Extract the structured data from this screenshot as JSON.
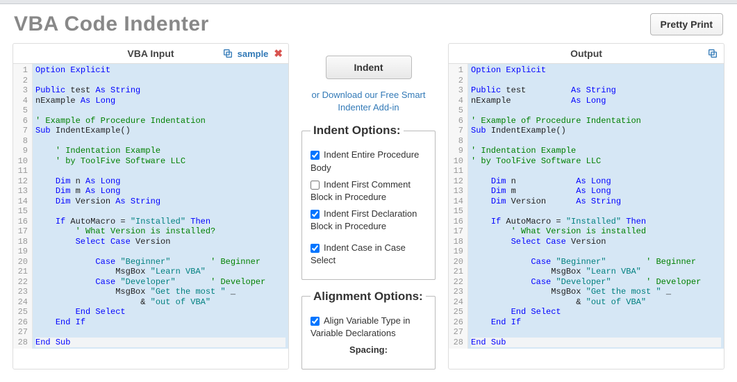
{
  "header": {
    "title": "VBA Code Indenter",
    "pretty_print": "Pretty Print"
  },
  "input_panel": {
    "title": "VBA Input",
    "sample_label": "sample",
    "clear_label": "✖",
    "code": [
      [
        [
          "kw",
          "Option"
        ],
        [
          "sp",
          " "
        ],
        [
          "kw",
          "Explicit"
        ]
      ],
      [],
      [
        [
          "kw",
          "Public"
        ],
        [
          "sp",
          " "
        ],
        [
          "id",
          "test "
        ],
        [
          "kw",
          "As"
        ],
        [
          "sp",
          " "
        ],
        [
          "kw",
          "String"
        ]
      ],
      [
        [
          "id",
          "nExample "
        ],
        [
          "kw",
          "As"
        ],
        [
          "sp",
          " "
        ],
        [
          "kw",
          "Long"
        ]
      ],
      [],
      [
        [
          "cm",
          "' Example of Procedure Indentation"
        ]
      ],
      [
        [
          "kw",
          "Sub"
        ],
        [
          "sp",
          " "
        ],
        [
          "id",
          "IndentExample()"
        ]
      ],
      [],
      [
        [
          "sp",
          "    "
        ],
        [
          "cm",
          "' Indentation Example"
        ]
      ],
      [
        [
          "sp",
          "    "
        ],
        [
          "cm",
          "' by ToolFive Software LLC"
        ]
      ],
      [],
      [
        [
          "sp",
          "    "
        ],
        [
          "kw",
          "Dim"
        ],
        [
          "sp",
          " "
        ],
        [
          "id",
          "n "
        ],
        [
          "kw",
          "As"
        ],
        [
          "sp",
          " "
        ],
        [
          "kw",
          "Long"
        ]
      ],
      [
        [
          "sp",
          "    "
        ],
        [
          "kw",
          "Dim"
        ],
        [
          "sp",
          " "
        ],
        [
          "id",
          "m "
        ],
        [
          "kw",
          "As"
        ],
        [
          "sp",
          " "
        ],
        [
          "kw",
          "Long"
        ]
      ],
      [
        [
          "sp",
          "    "
        ],
        [
          "kw",
          "Dim"
        ],
        [
          "sp",
          " "
        ],
        [
          "id",
          "Version "
        ],
        [
          "kw",
          "As"
        ],
        [
          "sp",
          " "
        ],
        [
          "kw",
          "String"
        ]
      ],
      [],
      [
        [
          "sp",
          "    "
        ],
        [
          "kw",
          "If"
        ],
        [
          "sp",
          " "
        ],
        [
          "id",
          "AutoMacro = "
        ],
        [
          "st",
          "\"Installed\""
        ],
        [
          "sp",
          " "
        ],
        [
          "kw",
          "Then"
        ]
      ],
      [
        [
          "sp",
          "        "
        ],
        [
          "cm",
          "' What Version is installed?"
        ]
      ],
      [
        [
          "sp",
          "        "
        ],
        [
          "kw",
          "Select"
        ],
        [
          "sp",
          " "
        ],
        [
          "kw",
          "Case"
        ],
        [
          "sp",
          " "
        ],
        [
          "id",
          "Version"
        ]
      ],
      [],
      [
        [
          "sp",
          "            "
        ],
        [
          "kw",
          "Case"
        ],
        [
          "sp",
          " "
        ],
        [
          "st",
          "\"Beginner\""
        ],
        [
          "sp",
          "        "
        ],
        [
          "cm",
          "' Beginner"
        ]
      ],
      [
        [
          "sp",
          "                "
        ],
        [
          "id",
          "MsgBox "
        ],
        [
          "st",
          "\"Learn VBA\""
        ]
      ],
      [
        [
          "sp",
          "            "
        ],
        [
          "kw",
          "Case"
        ],
        [
          "sp",
          " "
        ],
        [
          "st",
          "\"Developer\""
        ],
        [
          "sp",
          "       "
        ],
        [
          "cm",
          "' Developer"
        ]
      ],
      [
        [
          "sp",
          "                "
        ],
        [
          "id",
          "MsgBox "
        ],
        [
          "st",
          "\"Get the most \""
        ],
        [
          "id",
          " _"
        ]
      ],
      [
        [
          "sp",
          "                     "
        ],
        [
          "id",
          "& "
        ],
        [
          "st",
          "\"out of VBA\""
        ]
      ],
      [
        [
          "sp",
          "        "
        ],
        [
          "kw",
          "End"
        ],
        [
          "sp",
          " "
        ],
        [
          "kw",
          "Select"
        ]
      ],
      [
        [
          "sp",
          "    "
        ],
        [
          "kw",
          "End"
        ],
        [
          "sp",
          " "
        ],
        [
          "kw",
          "If"
        ]
      ],
      [],
      [
        [
          "kw",
          "End"
        ],
        [
          "sp",
          " "
        ],
        [
          "kw",
          "Sub"
        ]
      ]
    ]
  },
  "output_panel": {
    "title": "Output",
    "code": [
      [
        [
          "kw",
          "Option"
        ],
        [
          "sp",
          " "
        ],
        [
          "kw",
          "Explicit"
        ]
      ],
      [],
      [
        [
          "kw",
          "Public"
        ],
        [
          "sp",
          " "
        ],
        [
          "id",
          "test         "
        ],
        [
          "kw",
          "As"
        ],
        [
          "sp",
          " "
        ],
        [
          "kw",
          "String"
        ]
      ],
      [
        [
          "id",
          "nExample            "
        ],
        [
          "kw",
          "As"
        ],
        [
          "sp",
          " "
        ],
        [
          "kw",
          "Long"
        ]
      ],
      [],
      [
        [
          "cm",
          "' Example of Procedure Indentation"
        ]
      ],
      [
        [
          "kw",
          "Sub"
        ],
        [
          "sp",
          " "
        ],
        [
          "id",
          "IndentExample()"
        ]
      ],
      [],
      [
        [
          "cm",
          "' Indentation Example"
        ]
      ],
      [
        [
          "cm",
          "' by ToolFive Software LLC"
        ]
      ],
      [],
      [
        [
          "sp",
          "    "
        ],
        [
          "kw",
          "Dim"
        ],
        [
          "sp",
          " "
        ],
        [
          "id",
          "n            "
        ],
        [
          "kw",
          "As"
        ],
        [
          "sp",
          " "
        ],
        [
          "kw",
          "Long"
        ]
      ],
      [
        [
          "sp",
          "    "
        ],
        [
          "kw",
          "Dim"
        ],
        [
          "sp",
          " "
        ],
        [
          "id",
          "m            "
        ],
        [
          "kw",
          "As"
        ],
        [
          "sp",
          " "
        ],
        [
          "kw",
          "Long"
        ]
      ],
      [
        [
          "sp",
          "    "
        ],
        [
          "kw",
          "Dim"
        ],
        [
          "sp",
          " "
        ],
        [
          "id",
          "Version      "
        ],
        [
          "kw",
          "As"
        ],
        [
          "sp",
          " "
        ],
        [
          "kw",
          "String"
        ]
      ],
      [],
      [
        [
          "sp",
          "    "
        ],
        [
          "kw",
          "If"
        ],
        [
          "sp",
          " "
        ],
        [
          "id",
          "AutoMacro = "
        ],
        [
          "st",
          "\"Installed\""
        ],
        [
          "sp",
          " "
        ],
        [
          "kw",
          "Then"
        ]
      ],
      [
        [
          "sp",
          "        "
        ],
        [
          "cm",
          "' What Version is installed"
        ]
      ],
      [
        [
          "sp",
          "        "
        ],
        [
          "kw",
          "Select"
        ],
        [
          "sp",
          " "
        ],
        [
          "kw",
          "Case"
        ],
        [
          "sp",
          " "
        ],
        [
          "id",
          "Version"
        ]
      ],
      [],
      [
        [
          "sp",
          "            "
        ],
        [
          "kw",
          "Case"
        ],
        [
          "sp",
          " "
        ],
        [
          "st",
          "\"Beginner\""
        ],
        [
          "sp",
          "        "
        ],
        [
          "cm",
          "' Beginner"
        ]
      ],
      [
        [
          "sp",
          "                "
        ],
        [
          "id",
          "MsgBox "
        ],
        [
          "st",
          "\"Learn VBA\""
        ]
      ],
      [
        [
          "sp",
          "            "
        ],
        [
          "kw",
          "Case"
        ],
        [
          "sp",
          " "
        ],
        [
          "st",
          "\"Developer\""
        ],
        [
          "sp",
          "       "
        ],
        [
          "cm",
          "' Developer"
        ]
      ],
      [
        [
          "sp",
          "                "
        ],
        [
          "id",
          "MsgBox "
        ],
        [
          "st",
          "\"Get the most \""
        ],
        [
          "id",
          " _"
        ]
      ],
      [
        [
          "sp",
          "                     "
        ],
        [
          "id",
          "& "
        ],
        [
          "st",
          "\"out of VBA\""
        ]
      ],
      [
        [
          "sp",
          "        "
        ],
        [
          "kw",
          "End"
        ],
        [
          "sp",
          " "
        ],
        [
          "kw",
          "Select"
        ]
      ],
      [
        [
          "sp",
          "    "
        ],
        [
          "kw",
          "End"
        ],
        [
          "sp",
          " "
        ],
        [
          "kw",
          "If"
        ]
      ],
      [],
      [
        [
          "kw",
          "End"
        ],
        [
          "sp",
          " "
        ],
        [
          "kw",
          "Sub"
        ]
      ]
    ]
  },
  "middle": {
    "indent_button": "Indent",
    "download_link": "or Download our Free Smart Indenter Add-in",
    "indent_options_legend": "Indent Options:",
    "opt1": "Indent Entire Procedure Body",
    "opt2": "Indent First Comment Block in Procedure",
    "opt3": "Indent First Declaration Block in Procedure",
    "opt4": "Indent Case in Case Select",
    "alignment_legend": "Alignment Options:",
    "opt5": "Align Variable Type in Variable Declarations",
    "spacing_label": "Spacing:"
  }
}
